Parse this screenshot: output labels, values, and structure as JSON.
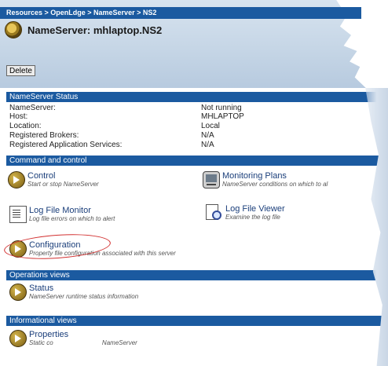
{
  "breadcrumb": "Resources > OpenLdge > NameServer > NS2",
  "page_title": "NameServer: mhlaptop.NS2",
  "delete_label": "Delete",
  "sections": {
    "status": "NameServer Status",
    "command": "Command and control",
    "operations": "Operations views",
    "informational": "Informational views"
  },
  "status_rows": [
    {
      "key": "NameServer:",
      "value": "Not running"
    },
    {
      "key": "Host:",
      "value": "MHLAPTOP"
    },
    {
      "key": "Location:",
      "value": "Local"
    },
    {
      "key": "Registered Brokers:",
      "value": "N/A"
    },
    {
      "key": "Registered Application Services:",
      "value": "N/A"
    }
  ],
  "command_items": {
    "control": {
      "label": "Control",
      "desc": "Start or stop NameServer"
    },
    "monitoring": {
      "label": "Monitoring Plans",
      "desc": "NameServer conditions on which to al"
    },
    "log_monitor": {
      "label": "Log File Monitor",
      "desc": "Log file errors on which to alert"
    },
    "log_viewer": {
      "label": "Log File Viewer",
      "desc": "Examine the log file"
    },
    "configuration": {
      "label": "Configuration",
      "desc": "Property file configuration associated with this server"
    }
  },
  "operations_items": {
    "status": {
      "label": "Status",
      "desc": "NameServer runtime status information"
    }
  },
  "informational_items": {
    "properties": {
      "label": "Properties",
      "desc": "Static co",
      "desc2": "NameServer"
    }
  },
  "colors": {
    "header_bar": "#1b5aa0",
    "annotation": "#d23030"
  }
}
